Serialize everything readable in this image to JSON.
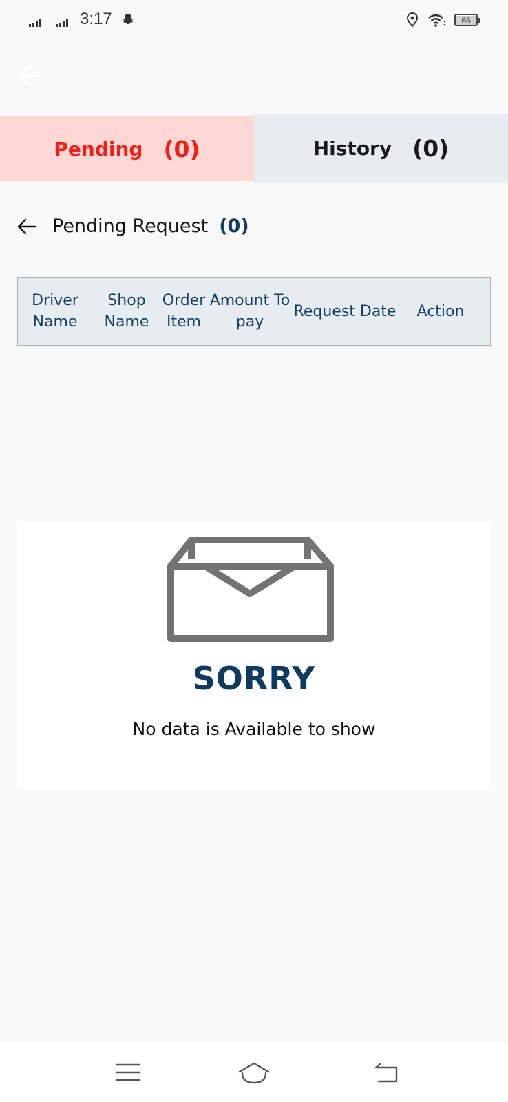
{
  "status_bar": {
    "time": "3:17",
    "battery": "65",
    "icons": [
      "signal-icon",
      "signal-icon",
      "snapchat-ghost-icon",
      "location-icon",
      "wifi-icon",
      "battery-icon"
    ]
  },
  "header": {
    "back_icon": "arrow-left-icon"
  },
  "tabs": [
    {
      "label": "Pending",
      "count": "(0)",
      "active": true,
      "color": "#ef2017",
      "bg": "#ffd8d6"
    },
    {
      "label": "History",
      "count": "(0)",
      "active": false,
      "color": "#1a1a1a",
      "bg": "#e7ecf0"
    }
  ],
  "section": {
    "title": "Pending Request",
    "count": "(0)",
    "back_icon": "arrow-left-icon"
  },
  "table": {
    "columns": [
      {
        "line1": "Driver",
        "line2": "Name"
      },
      {
        "line1": "Shop",
        "line2": "Name"
      },
      {
        "line1": "Order",
        "line2": "Item"
      },
      {
        "line1": "Amount To",
        "line2": "pay"
      },
      {
        "line1": "Request Date",
        "line2": ""
      },
      {
        "line1": "Action",
        "line2": ""
      }
    ]
  },
  "empty_state": {
    "icon": "empty-box-icon",
    "title": "SORRY",
    "message": "No data is Available to show"
  },
  "nav_bar": {
    "buttons": [
      "menu-icon",
      "home-icon",
      "back-icon"
    ]
  },
  "colors": {
    "accent_red": "#ef2017",
    "navy": "#163e62",
    "page_bg": "#f9f9f9"
  }
}
